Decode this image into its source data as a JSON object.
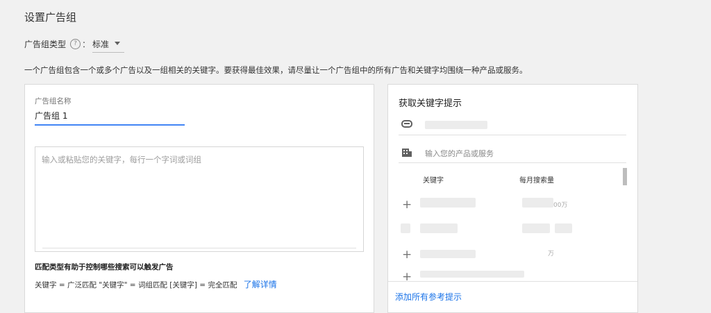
{
  "page": {
    "title": "设置广告组",
    "ad_group_type_label": "广告组类型",
    "help_icon_glyph": "?",
    "colon": "：",
    "ad_group_type_value": "标准",
    "description": "一个广告组包含一个或多个广告以及一组相关的关键字。要获得最佳效果，请尽量让一个广告组中的所有广告和关键字均围绕一种产品或服务。"
  },
  "left_card": {
    "name_label": "广告组名称",
    "name_value": "广告组 1",
    "keywords_placeholder": "输入或粘贴您的关键字，每行一个字词或词组",
    "match_title": "匹配类型有助于控制哪些搜索可以触发广告",
    "match_text": "关键字 = 广泛匹配  \"关键字\" = 词组匹配  [关键字] = 完全匹配",
    "learn_more": "了解详情"
  },
  "right_card": {
    "title": "获取关键字提示",
    "product_placeholder": "输入您的产品或服务",
    "col_keyword": "关键字",
    "col_monthly_searches": "每月搜索量",
    "row_partial_texts": [
      "00万",
      "",
      "万",
      ""
    ],
    "add_all": "添加所有参考提示",
    "plus_glyph": "+"
  },
  "icons": [
    "help-circle-icon",
    "dropdown-caret-icon",
    "link-icon",
    "building-icon",
    "plus-icon"
  ],
  "colors": {
    "link": "#1a73e8",
    "focus_underline": "#4285f4",
    "background": "#f1f1f1"
  }
}
